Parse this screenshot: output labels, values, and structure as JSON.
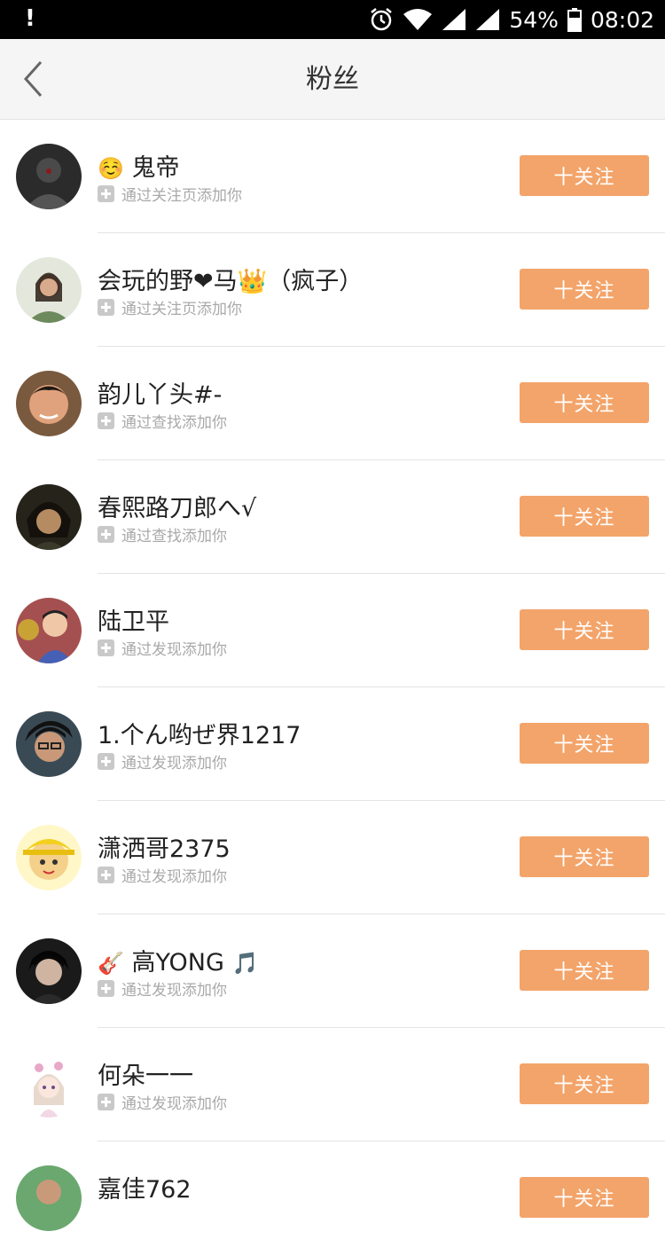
{
  "status_bar": {
    "notification": "!",
    "battery_percent": "54%",
    "time": "08:02"
  },
  "nav": {
    "title": "粉丝",
    "back_icon": "chevron-left-icon"
  },
  "follow_label": "十关注",
  "fans": [
    {
      "name": "鬼帝",
      "source": "通过关注页添加你",
      "prefix_icon": "smile-emoji",
      "suffix_icon": ""
    },
    {
      "name": "会玩的野❤马👑（疯子）",
      "source": "通过关注页添加你",
      "prefix_icon": "",
      "suffix_icon": ""
    },
    {
      "name": "韵儿丫头#-",
      "source": "通过查找添加你",
      "prefix_icon": "",
      "suffix_icon": ""
    },
    {
      "name": "春熙路刀郎へ√",
      "source": "通过查找添加你",
      "prefix_icon": "",
      "suffix_icon": ""
    },
    {
      "name": "陆卫平",
      "source": "通过发现添加你",
      "prefix_icon": "",
      "suffix_icon": ""
    },
    {
      "name": "1.个ん哟ぜ界1217",
      "source": "通过发现添加你",
      "prefix_icon": "",
      "suffix_icon": ""
    },
    {
      "name": "潇洒哥2375",
      "source": "通过发现添加你",
      "prefix_icon": "",
      "suffix_icon": ""
    },
    {
      "name": "高YONG",
      "source": "通过发现添加你",
      "prefix_icon": "guitar-emoji",
      "suffix_icon": "music-note-emoji"
    },
    {
      "name": "何朵一一",
      "source": "通过发现添加你",
      "prefix_icon": "",
      "suffix_icon": ""
    },
    {
      "name": "嘉佳762",
      "source": "",
      "prefix_icon": "",
      "suffix_icon": ""
    }
  ]
}
